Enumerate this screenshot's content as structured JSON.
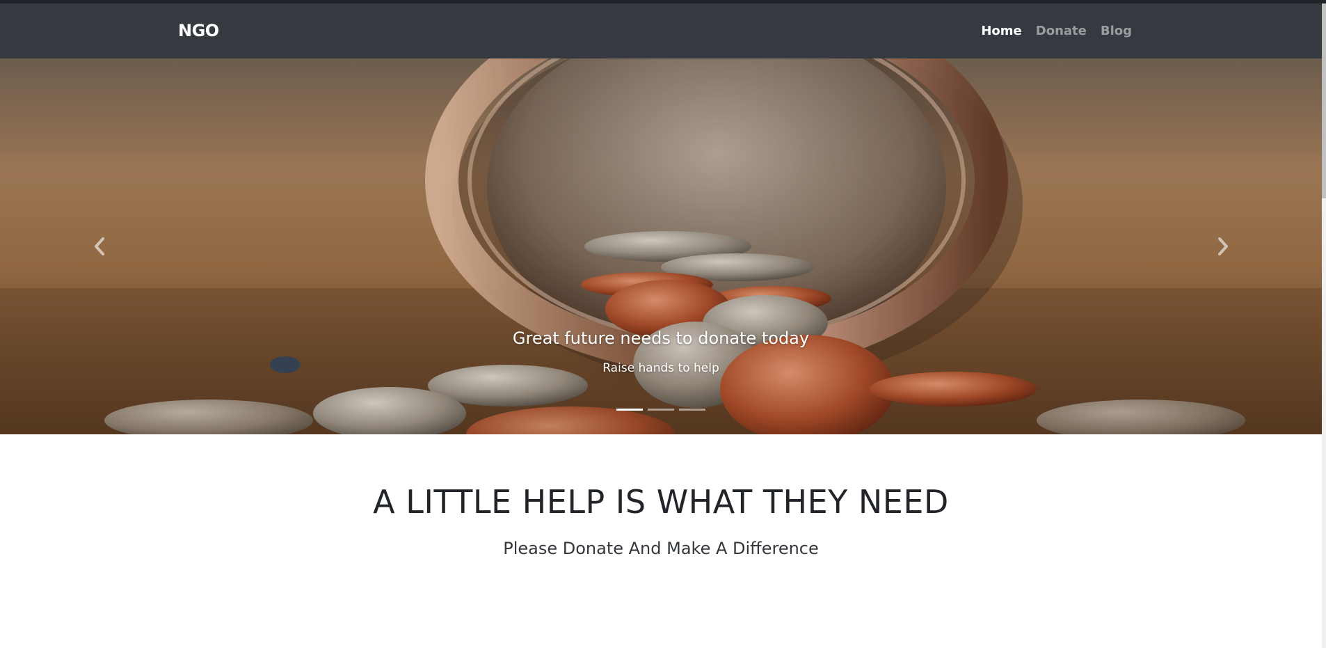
{
  "navbar": {
    "brand": "NGO",
    "links": [
      {
        "label": "Home",
        "active": true
      },
      {
        "label": "Donate",
        "active": false
      },
      {
        "label": "Blog",
        "active": false
      }
    ]
  },
  "carousel": {
    "caption_title": "Great future needs to donate today",
    "caption_text": "Raise hands to help",
    "slide_count": 3,
    "active_slide": 1,
    "prev_icon": "chevron-left-icon",
    "next_icon": "chevron-right-icon"
  },
  "main": {
    "heading": "A LITTLE HELP IS WHAT THEY NEED",
    "subheading": "Please Donate And Make A Difference"
  },
  "colors": {
    "navbar_bg": "#343a40",
    "nav_active": "#ffffff",
    "nav_inactive": "rgba(255,255,255,0.5)",
    "text_dark": "#212529"
  }
}
